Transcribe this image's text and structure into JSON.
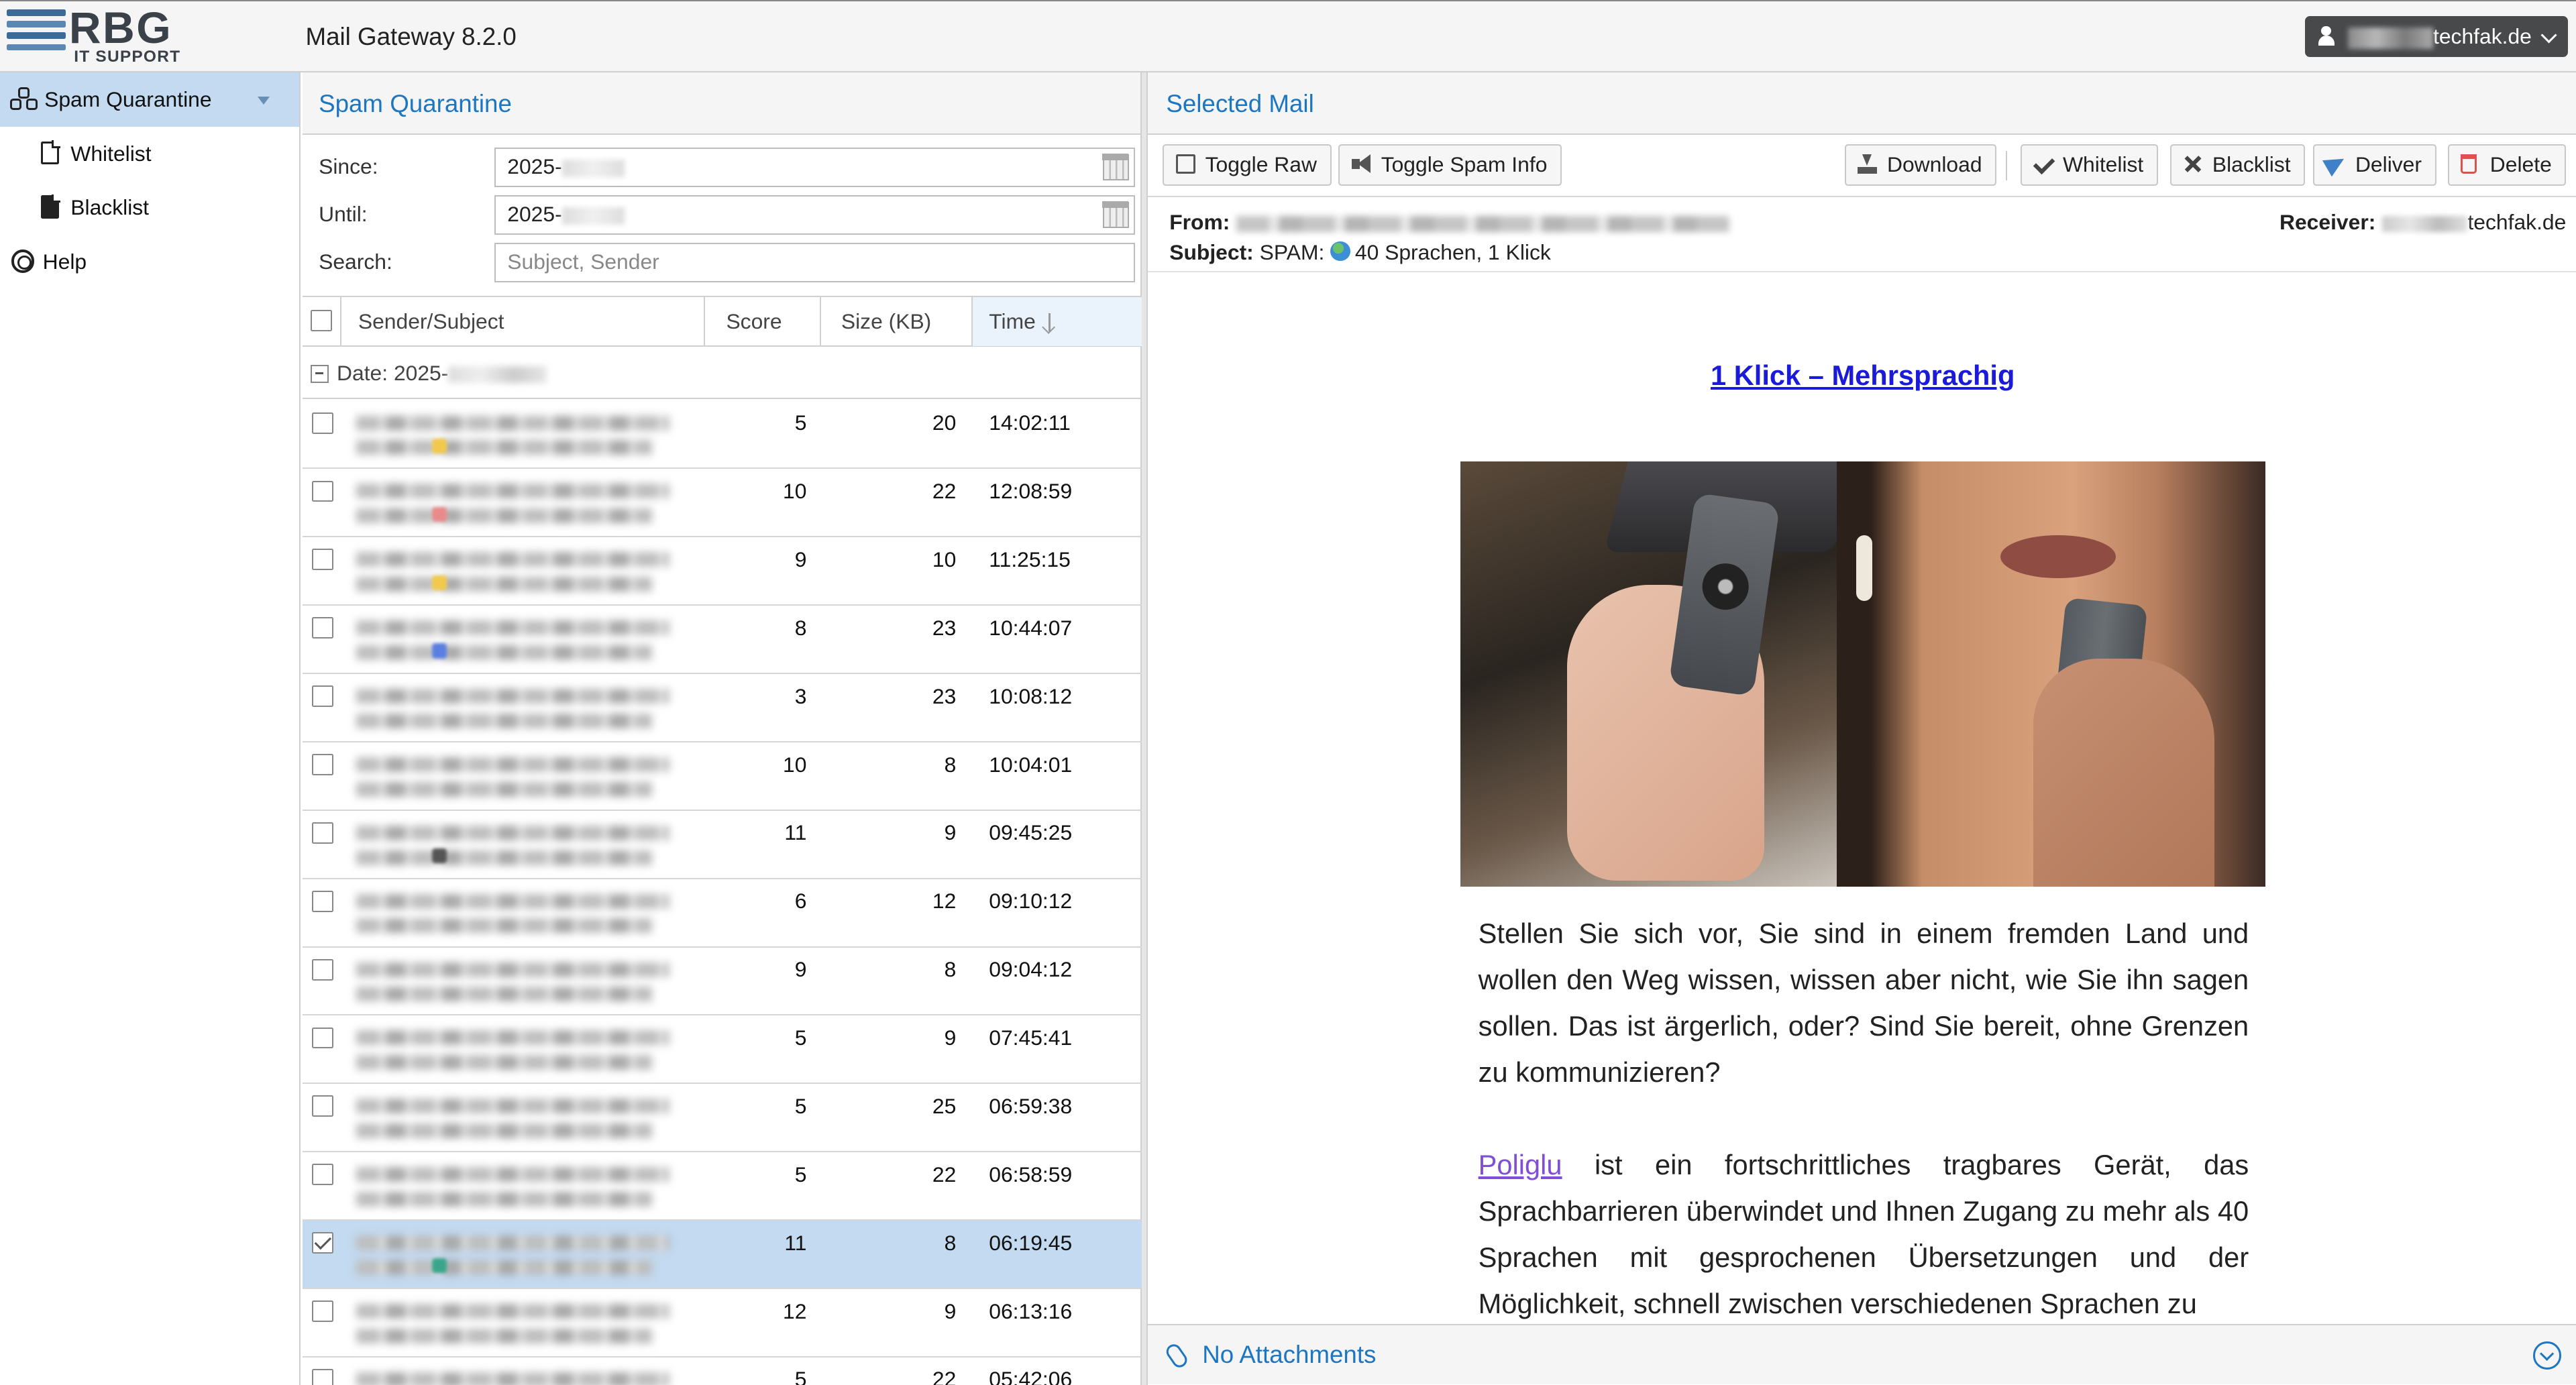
{
  "app": {
    "logo_main": "RBG",
    "logo_sub": "IT SUPPORT",
    "title": "Mail Gateway 8.2.0",
    "user_suffix": "techfak.de"
  },
  "sidebar": {
    "items": [
      {
        "label": "Spam Quarantine",
        "icon": "sitemap-icon",
        "active": true
      },
      {
        "label": "Whitelist",
        "icon": "file-outline-icon"
      },
      {
        "label": "Blacklist",
        "icon": "file-solid-icon"
      },
      {
        "label": "Help",
        "icon": "lifebuoy-icon"
      }
    ]
  },
  "list": {
    "header": "Spam Quarantine",
    "filters": {
      "since_label": "Since:",
      "since_value": "2025-",
      "until_label": "Until:",
      "until_value": "2025-",
      "search_label": "Search:",
      "search_placeholder": "Subject, Sender"
    },
    "columns": {
      "subject": "Sender/Subject",
      "score": "Score",
      "size": "Size (KB)",
      "time": "Time"
    },
    "group_label": "Date: 2025-",
    "rows": [
      {
        "score": "5",
        "size": "20",
        "time": "14:02:11",
        "dot": "#f2c94c"
      },
      {
        "score": "10",
        "size": "22",
        "time": "12:08:59",
        "dot": "#e88a8a"
      },
      {
        "score": "9",
        "size": "10",
        "time": "11:25:15",
        "dot": "#f2c94c"
      },
      {
        "score": "8",
        "size": "23",
        "time": "10:44:07",
        "dot": "#5a7fe0"
      },
      {
        "score": "3",
        "size": "23",
        "time": "10:08:12",
        "dot": ""
      },
      {
        "score": "10",
        "size": "8",
        "time": "10:04:01",
        "dot": ""
      },
      {
        "score": "11",
        "size": "9",
        "time": "09:45:25",
        "dot": "#555555"
      },
      {
        "score": "6",
        "size": "12",
        "time": "09:10:12",
        "dot": ""
      },
      {
        "score": "9",
        "size": "8",
        "time": "09:04:12",
        "dot": ""
      },
      {
        "score": "5",
        "size": "9",
        "time": "07:45:41",
        "dot": ""
      },
      {
        "score": "5",
        "size": "25",
        "time": "06:59:38",
        "dot": ""
      },
      {
        "score": "5",
        "size": "22",
        "time": "06:58:59",
        "dot": ""
      },
      {
        "score": "11",
        "size": "8",
        "time": "06:19:45",
        "dot": "#3aa58a",
        "selected": true
      },
      {
        "score": "12",
        "size": "9",
        "time": "06:13:16",
        "dot": ""
      },
      {
        "score": "5",
        "size": "22",
        "time": "05:42:06",
        "dot": ""
      }
    ]
  },
  "mail": {
    "header": "Selected Mail",
    "toolbar": {
      "toggle_raw": "Toggle Raw",
      "toggle_spam": "Toggle Spam Info",
      "download": "Download",
      "whitelist": "Whitelist",
      "blacklist": "Blacklist",
      "deliver": "Deliver",
      "delete": "Delete"
    },
    "from_label": "From:",
    "subject_label": "Subject:",
    "subject_prefix": "SPAM:",
    "subject_text": "40 Sprachen, 1 Klick",
    "receiver_label": "Receiver:",
    "receiver_suffix": "techfak.de",
    "body": {
      "link": "1 Klick – Mehrsprachig",
      "para1": "Stellen Sie sich vor, Sie sind in einem fremden Land und wollen den Weg wissen, wissen aber nicht, wie Sie ihn sagen sollen. Das ist ärgerlich, oder? Sind Sie bereit, ohne Grenzen zu kommunizieren?",
      "para2_link": "Poliglu",
      "para2_rest": " ist ein fortschrittliches tragbares Gerät, das Sprachbarrieren überwindet und Ihnen Zugang zu mehr als 40 Sprachen mit gesprochenen Übersetzungen und der Möglichkeit, schnell zwischen verschiedenen Sprachen zu"
    },
    "attachments": "No Attachments"
  }
}
